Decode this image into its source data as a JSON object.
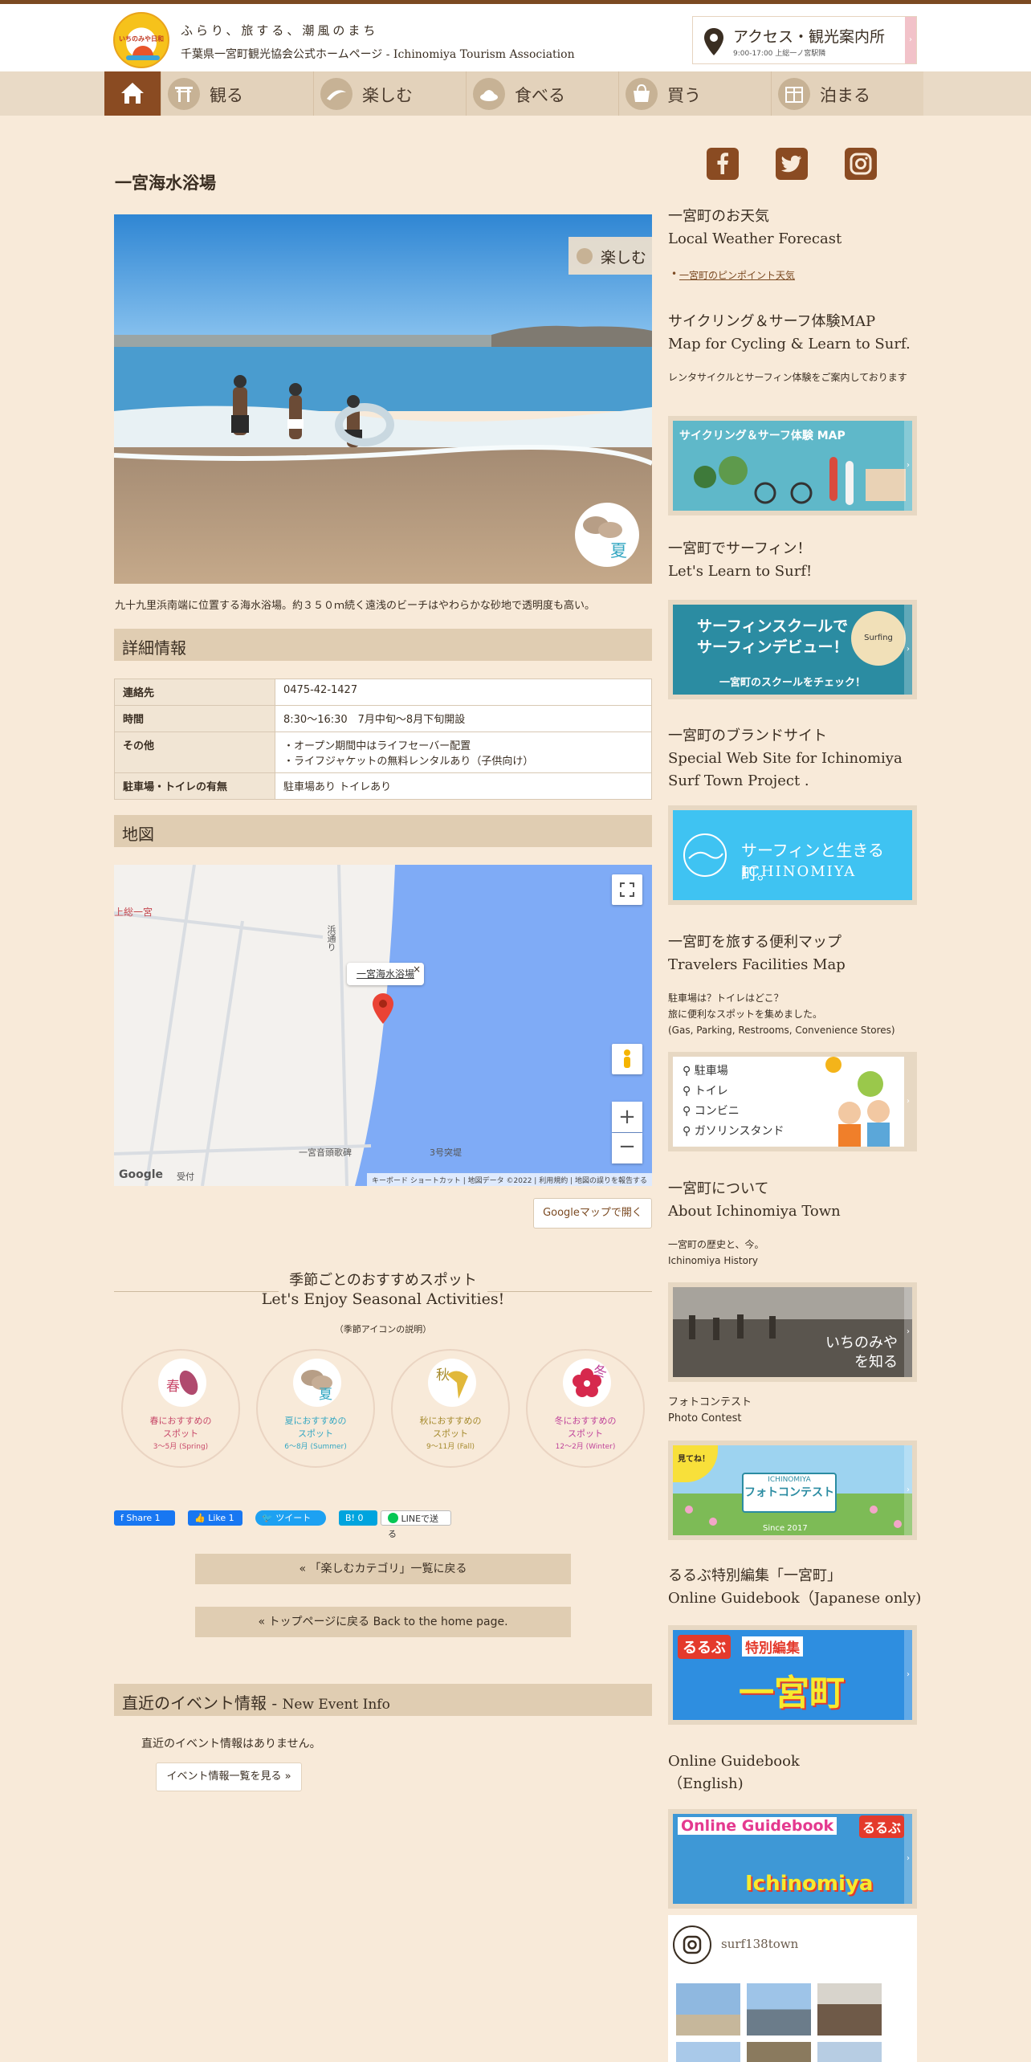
{
  "header": {
    "logo_text": "いちのみや日和",
    "tagline": "ふらり、旅する、潮風のまち",
    "site_title": "千葉県一宮町観光協会公式ホームページ - Ichinomiya Tourism Association",
    "access_title": "アクセス・観光案内所",
    "access_sub": "9:00-17:00 上総一ノ宮駅隣"
  },
  "nav": {
    "items": [
      {
        "label": "観る",
        "icon": "torii-icon"
      },
      {
        "label": "楽しむ",
        "icon": "surf-icon"
      },
      {
        "label": "食べる",
        "icon": "food-icon"
      },
      {
        "label": "買う",
        "icon": "shopping-icon"
      },
      {
        "label": "泊まる",
        "icon": "lodging-icon"
      }
    ]
  },
  "article": {
    "title": "一宮海水浴場",
    "category_badge": "楽しむ",
    "season_badge": "夏",
    "description": "九十九里浜南端に位置する海水浴場。約３５０ｍ続く遠浅のビーチはやわらかな砂地で透明度も高い。",
    "details_heading": "詳細情報",
    "details": [
      {
        "key": "連絡先",
        "value": "0475-42-1427"
      },
      {
        "key": "時間",
        "value": "8:30～16:30　7月中旬～8月下旬開設"
      },
      {
        "key": "その他",
        "value": "・オープン期間中はライフセーバー配置\n・ライフジャケットの無料レンタルあり（子供向け）"
      },
      {
        "key": "駐車場・トイレの有無",
        "value": "駐車場あり トイレあり"
      }
    ],
    "map_heading": "地図",
    "map": {
      "popup": "一宮海水浴場",
      "place_label_left": "上総一宮",
      "road_label": "浜通り",
      "place_label_shrine": "一宮音頭歌碑",
      "place_label_bank": "3号突堤",
      "place_label_reception": "受付",
      "google_logo": "Google",
      "footer_shortcuts": "キーボード ショートカット",
      "footer_data": "地図データ ©2022",
      "footer_terms": "利用規約",
      "footer_report": "地図の誤りを報告する"
    },
    "map_button": "Googleマップで開く",
    "seasonal_title_ja": "季節ごとのおすすめスポット",
    "seasonal_title_en": "Let's Enjoy Seasonal Activities!",
    "seasonal_expl": "（季節アイコンの説明）",
    "seasons": [
      {
        "char": "春",
        "line1": "春におすすめの",
        "line2": "スポット",
        "range": "3～5月 (Spring)",
        "color": "#c8496a"
      },
      {
        "char": "夏",
        "line1": "夏におすすめの",
        "line2": "スポット",
        "range": "6～8月 (Summer)",
        "color": "#34a7c2"
      },
      {
        "char": "秋",
        "line1": "秋におすすめの",
        "line2": "スポット",
        "range": "9～11月 (Fall)",
        "color": "#a58a2c"
      },
      {
        "char": "冬",
        "line1": "冬におすすめの",
        "line2": "スポット",
        "range": "12～2月 (Winter)",
        "color": "#c0439a"
      }
    ],
    "share": {
      "facebook": "Share 1",
      "like": "Like 1",
      "tweet": "ツイート",
      "hatena": "0",
      "line": "LINEで送る"
    },
    "back_category": "« 「楽しむカテゴリ」一覧に戻る",
    "back_top": "« トップページに戻る Back to the home page.",
    "events_heading": "直近のイベント情報 - ",
    "events_heading_en": "New Event Info",
    "no_events": "直近のイベント情報はありません。",
    "events_button": "イベント情報一覧を見る »"
  },
  "sidebar": {
    "weather_h1": "一宮町のお天気",
    "weather_h2": "Local Weather Forecast",
    "weather_link": "一宮町のピンポイント天気",
    "cycling_h1": "サイクリング＆サーフ体験MAP",
    "cycling_h2": "Map for Cycling & Learn to Surf.",
    "cycling_p": "レンタサイクルとサーフィン体験をご案内しております",
    "cycling_banner": "サイクリング＆サーフ体験 MAP",
    "surf_h1": "一宮町でサーフィン！",
    "surf_h2": "Let's Learn to Surf!",
    "surf_banner_1": "サーフィンスクールで",
    "surf_banner_2": "サーフィンデビュー！",
    "surf_banner_3": "一宮町のスクールをチェック！",
    "surf_banner_badge": "Surfing",
    "brand_h1": "一宮町のブランドサイト",
    "brand_h2": "Special Web Site for Ichinomiya",
    "brand_h3": "Surf Town Project .",
    "brand_banner_1": "サーフィンと生きる町。",
    "brand_banner_2": "ICHINOMIYA",
    "travel_h1": "一宮町を旅する便利マップ",
    "travel_h2": "Travelers Facilities Map",
    "travel_p1": "駐車場は？トイレはどこ？",
    "travel_p2": "旅に便利なスポットを集めました。",
    "travel_p3": "(Gas, Parking, Restrooms, Convenience Stores)",
    "travel_items": [
      "駐車場",
      "トイレ",
      "コンビニ",
      "ガソリンスタンド"
    ],
    "about_h1": "一宮町について",
    "about_h2": "About Ichinomiya Town",
    "about_p1": "一宮町の歴史と、今。",
    "about_p2": "Ichinomiya History",
    "about_banner_1": "いちのみや",
    "about_banner_2": "を知る",
    "photo_p1": "フォトコンテスト",
    "photo_p2": "Photo Contest",
    "photo_banner_tag": "見てね！",
    "photo_banner_title": "フォトコンテスト",
    "photo_banner_logo": "ICHINOMIYA",
    "photo_banner_since": "Since 2017",
    "rurubu_h1": "るるぶ特別編集「一宮町」",
    "rurubu_h2": "Online Guidebook（Japanese only)",
    "rurubu_banner_tag": "特別編集",
    "rurubu_banner_title": "一宮町",
    "rurubu_logo": "るるぶ",
    "guide_h1": "Online Guidebook",
    "guide_h2": "（English)",
    "guide_banner_1": "Online Guidebook",
    "guide_banner_2": "Ichinomiya",
    "instagram_user": "surf138town"
  },
  "colors": {
    "background": "#f8ead9",
    "brown": "#8a4b22",
    "section": "#e0cdb2"
  }
}
